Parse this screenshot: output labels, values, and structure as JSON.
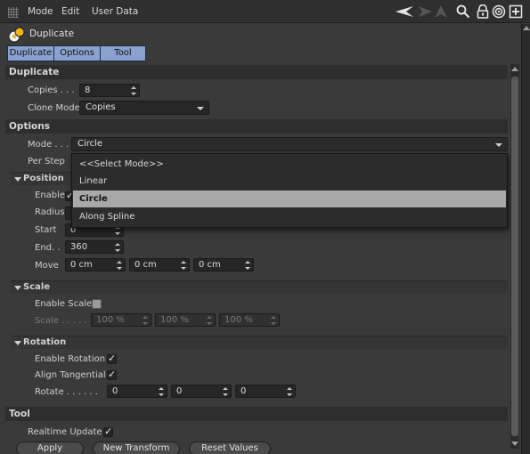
{
  "menubar": {
    "items": [
      "Mode",
      "Edit",
      "User Data"
    ],
    "icons": [
      "back-arrow-icon",
      "forward-arrow-icon",
      "search-icon",
      "lock-icon",
      "target-icon",
      "new-panel-icon"
    ]
  },
  "title": {
    "text": "Duplicate",
    "icon": "duplicate-tool-icon"
  },
  "tabs": [
    "Duplicate",
    "Options",
    "Tool"
  ],
  "sections": {
    "duplicate": "Duplicate",
    "options": "Options",
    "position": "Position",
    "scale": "Scale",
    "rotation": "Rotation",
    "tool": "Tool"
  },
  "duplicate": {
    "copies_label": "Copies . . .",
    "copies_value": "8",
    "clone_mode_label": "Clone Mode",
    "clone_mode_value": "Copies"
  },
  "options": {
    "mode_label": "Mode . . .",
    "mode_value": "Circle",
    "per_step_label": "Per Step",
    "popup_items": [
      "<<Select Mode>>",
      "Linear",
      "Circle",
      "Along Spline"
    ]
  },
  "position": {
    "enable_label": "Enable",
    "radius_label": "Radius",
    "start_label": "Start",
    "start_value": "0",
    "end_label": "End. .",
    "end_value": "360",
    "move_label": "Move",
    "move_values": [
      "0 cm",
      "0 cm",
      "0 cm"
    ]
  },
  "scale": {
    "enable_label": "Enable Scale",
    "scale_label": "Scale . . . . .",
    "scale_values": [
      "100 %",
      "100 %",
      "100 %"
    ]
  },
  "rotation": {
    "enable_label": "Enable Rotation",
    "align_label": "Align Tangential",
    "rotate_label": "Rotate . . . . . .",
    "rotate_values": [
      "0",
      "0",
      "0"
    ]
  },
  "tool": {
    "realtime_label": "Realtime Update",
    "buttons": [
      "Apply",
      "New Transform",
      "Reset Values"
    ]
  },
  "colors": {
    "tab_bg": "#8aa2cf",
    "selected_item": "#a8a8a8",
    "panel_bg": "#3a3a3a"
  }
}
